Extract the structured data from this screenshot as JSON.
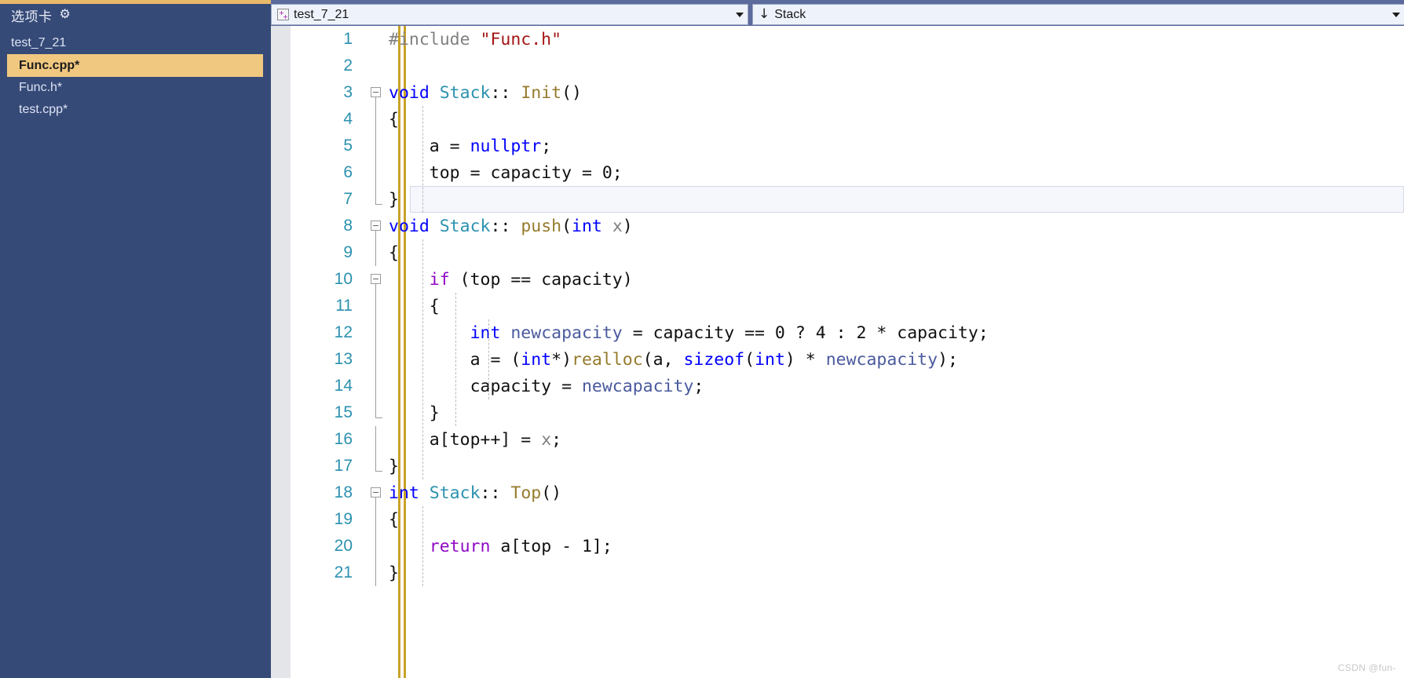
{
  "sidebar": {
    "header": {
      "title": "选项卡",
      "settings_icon": "gear-icon"
    },
    "items": [
      {
        "label": "test_7_21",
        "type": "group",
        "selected": false
      },
      {
        "label": "Func.cpp*",
        "type": "file",
        "selected": true
      },
      {
        "label": "Func.h*",
        "type": "file",
        "selected": false
      },
      {
        "label": "test.cpp*",
        "type": "file",
        "selected": false
      }
    ],
    "background": "#364a78",
    "selected_background": "#f0c880"
  },
  "toolbar": {
    "project_combo": {
      "value": "test_7_21",
      "icon": "cpp-project-icon",
      "caret": "chevron-down-icon"
    },
    "member_combo": {
      "value": "Stack",
      "icon": "down-arrow-icon",
      "caret": "chevron-down-icon"
    }
  },
  "editor": {
    "language": "C++",
    "current_line": 7,
    "lines": [
      {
        "n": "1",
        "fold": "none",
        "text": "#include \"Func.h\""
      },
      {
        "n": "2",
        "fold": "none",
        "text": ""
      },
      {
        "n": "3",
        "fold": "start",
        "text": "void Stack:: Init()"
      },
      {
        "n": "4",
        "fold": "stem",
        "text": "{"
      },
      {
        "n": "5",
        "fold": "stem",
        "text": "    a = nullptr;"
      },
      {
        "n": "6",
        "fold": "stem",
        "text": "    top = capacity = 0;"
      },
      {
        "n": "7",
        "fold": "end",
        "text": "}"
      },
      {
        "n": "8",
        "fold": "start",
        "text": "void Stack:: push(int x)"
      },
      {
        "n": "9",
        "fold": "stem",
        "text": "{"
      },
      {
        "n": "10",
        "fold": "start2",
        "text": "    if (top == capacity)"
      },
      {
        "n": "11",
        "fold": "stem",
        "text": "    {"
      },
      {
        "n": "12",
        "fold": "stem",
        "text": "        int newcapacity = capacity == 0 ? 4 : 2 * capacity;"
      },
      {
        "n": "13",
        "fold": "stem",
        "text": "        a = (int*)realloc(a, sizeof(int) * newcapacity);"
      },
      {
        "n": "14",
        "fold": "stem",
        "text": "        capacity = newcapacity;"
      },
      {
        "n": "15",
        "fold": "end2",
        "text": "    }"
      },
      {
        "n": "16",
        "fold": "stem",
        "text": "    a[top++] = x;"
      },
      {
        "n": "17",
        "fold": "end",
        "text": "}"
      },
      {
        "n": "18",
        "fold": "start",
        "text": "int Stack:: Top()"
      },
      {
        "n": "19",
        "fold": "stem",
        "text": "{"
      },
      {
        "n": "20",
        "fold": "stem",
        "text": "    return a[top - 1];"
      },
      {
        "n": "21",
        "fold": "stem",
        "text": "}"
      }
    ],
    "colors": {
      "preprocessor": "#808080",
      "string": "#a31515",
      "keyword": "#0000ff",
      "type": "#2b91af",
      "function": "#957b2c",
      "control": "#8f08c4",
      "parameter": "#808080",
      "local": "#4a5a9e",
      "line_number": "#2b91af",
      "change_bar": "#c9a227"
    }
  },
  "watermark": {
    "text": "CSDN @fun-"
  }
}
